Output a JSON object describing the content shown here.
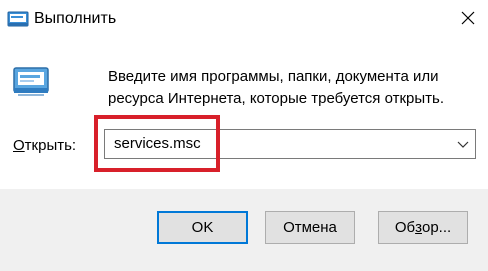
{
  "window": {
    "title": "Выполнить",
    "icon": "run-app-icon",
    "close_icon": "close-icon"
  },
  "description": "Введите имя программы, папки, документа или ресурса Интернета, которые требуется открыть.",
  "open_field": {
    "label": "Открыть:",
    "label_accel": "О",
    "label_rest": "ткрыть:",
    "value": "services.msc",
    "dropdown_icon": "chevron-down-icon"
  },
  "buttons": {
    "ok": "OK",
    "cancel": "Отмена",
    "browse_accel_before": "Об",
    "browse_accel": "з",
    "browse_after": "ор..."
  },
  "colors": {
    "highlight": "#d8202a",
    "default_button_border": "#0078d7",
    "footer_bg": "#f0f0f0"
  }
}
